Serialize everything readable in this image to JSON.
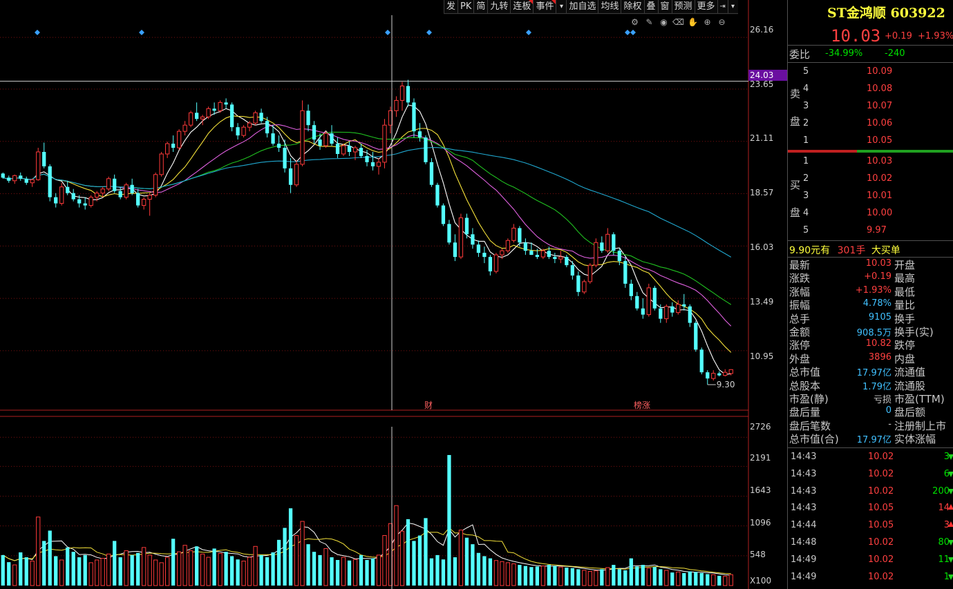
{
  "toolbar": {
    "buttons": [
      "发",
      "PK",
      "简",
      "九转",
      "连板",
      "事件",
      "▾",
      "加自选",
      "均线",
      "除权",
      "叠",
      "窗",
      "预测",
      "更多",
      "⇥",
      "▾"
    ]
  },
  "chart_data": [
    {
      "type": "candlestick",
      "title": "",
      "price_axis_ticks": [
        "26.16",
        "23.65",
        "21.11",
        "18.57",
        "16.03",
        "13.49",
        "10.95"
      ],
      "ylim": [
        9.0,
        26.5
      ],
      "cursor_price": "24.03",
      "low_marker": "9.30",
      "event_markers": [
        "财",
        "榜涨"
      ],
      "moving_average_colors": [
        "#ffffff",
        "#f5e23a",
        "#e060e0",
        "#20c020",
        "#20a8d0"
      ],
      "up_color": "#ff3a3a",
      "down_color": "#54ffff",
      "candles": [
        [
          19.55,
          19.6,
          19.3,
          19.35
        ],
        [
          19.35,
          19.45,
          19.1,
          19.2
        ],
        [
          19.2,
          19.5,
          19.05,
          19.45
        ],
        [
          19.45,
          19.6,
          19.2,
          19.3
        ],
        [
          19.3,
          19.4,
          19.0,
          19.1
        ],
        [
          19.1,
          19.3,
          18.9,
          19.25
        ],
        [
          19.25,
          20.8,
          19.2,
          20.6
        ],
        [
          20.6,
          21.05,
          19.8,
          19.9
        ],
        [
          19.9,
          20.0,
          18.2,
          18.4
        ],
        [
          18.4,
          18.6,
          17.9,
          18.1
        ],
        [
          18.1,
          19.1,
          18.0,
          18.9
        ],
        [
          18.9,
          19.2,
          18.5,
          18.6
        ],
        [
          18.6,
          18.8,
          18.2,
          18.3
        ],
        [
          18.3,
          18.5,
          17.9,
          18.1
        ],
        [
          18.1,
          18.4,
          17.8,
          18.0
        ],
        [
          18.0,
          18.5,
          17.9,
          18.4
        ],
        [
          18.4,
          18.7,
          18.2,
          18.6
        ],
        [
          18.6,
          18.9,
          18.4,
          18.8
        ],
        [
          18.8,
          19.4,
          18.7,
          19.3
        ],
        [
          19.3,
          19.5,
          18.6,
          18.7
        ],
        [
          18.7,
          18.9,
          18.3,
          18.4
        ],
        [
          18.4,
          19.1,
          18.3,
          19.0
        ],
        [
          19.0,
          19.3,
          18.5,
          18.6
        ],
        [
          18.6,
          18.8,
          17.9,
          18.0
        ],
        [
          18.0,
          18.4,
          17.8,
          18.3
        ],
        [
          18.3,
          18.6,
          17.5,
          18.5
        ],
        [
          18.5,
          19.6,
          18.4,
          19.5
        ],
        [
          19.5,
          20.6,
          19.4,
          20.5
        ],
        [
          20.5,
          21.1,
          20.3,
          21.0
        ],
        [
          21.0,
          21.4,
          20.6,
          20.8
        ],
        [
          20.8,
          21.7,
          20.7,
          21.6
        ],
        [
          21.6,
          22.1,
          21.4,
          21.9
        ],
        [
          21.9,
          22.6,
          21.8,
          22.5
        ],
        [
          22.5,
          23.0,
          22.1,
          22.2
        ],
        [
          22.2,
          22.4,
          21.9,
          22.3
        ],
        [
          22.3,
          22.8,
          22.2,
          22.7
        ],
        [
          22.7,
          23.0,
          22.4,
          22.6
        ],
        [
          22.6,
          23.1,
          22.5,
          23.0
        ],
        [
          23.0,
          23.2,
          22.7,
          22.9
        ],
        [
          22.9,
          23.0,
          21.6,
          21.8
        ],
        [
          21.8,
          22.0,
          21.2,
          21.4
        ],
        [
          21.4,
          21.9,
          21.3,
          21.8
        ],
        [
          21.8,
          22.1,
          21.6,
          22.0
        ],
        [
          22.0,
          22.6,
          21.9,
          22.5
        ],
        [
          22.5,
          22.7,
          22.0,
          22.1
        ],
        [
          22.1,
          22.3,
          21.3,
          21.5
        ],
        [
          21.5,
          21.9,
          20.9,
          21.0
        ],
        [
          21.0,
          21.4,
          20.6,
          20.8
        ],
        [
          20.8,
          21.2,
          19.6,
          19.8
        ],
        [
          19.8,
          20.3,
          18.6,
          19.0
        ],
        [
          19.0,
          20.2,
          18.9,
          20.0
        ],
        [
          20.0,
          23.1,
          19.9,
          22.6
        ],
        [
          22.6,
          22.9,
          21.6,
          21.9
        ],
        [
          21.9,
          22.1,
          21.0,
          21.2
        ],
        [
          21.2,
          21.5,
          20.7,
          20.9
        ],
        [
          20.9,
          21.6,
          20.8,
          21.5
        ],
        [
          21.5,
          21.9,
          20.9,
          21.0
        ],
        [
          21.0,
          21.3,
          20.3,
          20.5
        ],
        [
          20.5,
          21.0,
          20.4,
          20.9
        ],
        [
          20.9,
          21.1,
          20.4,
          20.6
        ],
        [
          20.6,
          20.9,
          20.2,
          20.8
        ],
        [
          20.8,
          21.0,
          20.3,
          20.4
        ],
        [
          20.4,
          20.7,
          19.9,
          20.1
        ],
        [
          20.1,
          20.6,
          19.7,
          19.9
        ],
        [
          19.9,
          20.3,
          19.5,
          20.1
        ],
        [
          20.1,
          22.2,
          19.8,
          21.9
        ],
        [
          21.9,
          22.8,
          21.5,
          22.6
        ],
        [
          22.6,
          23.3,
          22.3,
          23.1
        ],
        [
          23.1,
          24.0,
          22.6,
          23.8
        ],
        [
          23.8,
          24.1,
          22.8,
          23.0
        ],
        [
          23.0,
          23.2,
          21.3,
          21.6
        ],
        [
          21.6,
          22.0,
          21.1,
          21.3
        ],
        [
          21.3,
          21.4,
          20.0,
          20.1
        ],
        [
          20.1,
          20.3,
          18.9,
          19.0
        ],
        [
          19.0,
          19.1,
          17.9,
          18.0
        ],
        [
          18.0,
          18.1,
          17.0,
          17.1
        ],
        [
          17.1,
          17.3,
          16.1,
          16.2
        ],
        [
          16.2,
          16.6,
          15.3,
          15.5
        ],
        [
          15.5,
          17.6,
          15.4,
          17.4
        ],
        [
          17.4,
          17.6,
          16.4,
          16.6
        ],
        [
          16.6,
          16.9,
          15.9,
          16.1
        ],
        [
          16.1,
          16.3,
          15.5,
          15.7
        ],
        [
          15.7,
          16.0,
          15.2,
          15.5
        ],
        [
          15.5,
          15.6,
          14.6,
          14.8
        ],
        [
          14.8,
          15.7,
          14.7,
          15.6
        ],
        [
          15.6,
          15.9,
          15.4,
          15.8
        ],
        [
          15.8,
          16.4,
          15.7,
          16.3
        ],
        [
          16.3,
          17.1,
          16.2,
          16.9
        ],
        [
          16.9,
          17.0,
          16.0,
          16.2
        ],
        [
          16.2,
          16.4,
          15.6,
          15.8
        ],
        [
          15.8,
          16.2,
          15.6,
          15.6
        ],
        [
          15.6,
          15.9,
          15.4,
          15.5
        ],
        [
          15.5,
          15.9,
          15.4,
          15.8
        ],
        [
          15.8,
          16.0,
          15.4,
          15.5
        ],
        [
          15.5,
          15.7,
          15.2,
          15.4
        ],
        [
          15.4,
          15.8,
          15.2,
          15.5
        ],
        [
          15.5,
          15.6,
          15.0,
          15.1
        ],
        [
          15.1,
          15.3,
          14.4,
          14.6
        ],
        [
          14.6,
          14.8,
          13.6,
          13.8
        ],
        [
          13.8,
          14.4,
          13.7,
          14.3
        ],
        [
          14.3,
          15.2,
          14.2,
          15.1
        ],
        [
          15.1,
          16.4,
          15.0,
          16.2
        ],
        [
          16.2,
          16.5,
          15.7,
          15.8
        ],
        [
          15.8,
          16.9,
          15.7,
          16.6
        ],
        [
          16.6,
          16.7,
          15.6,
          15.8
        ],
        [
          15.8,
          15.9,
          15.1,
          15.3
        ],
        [
          15.3,
          15.5,
          14.0,
          14.2
        ],
        [
          14.2,
          14.4,
          13.4,
          13.6
        ],
        [
          13.6,
          13.8,
          12.9,
          13.0
        ],
        [
          13.0,
          13.5,
          12.5,
          12.7
        ],
        [
          12.7,
          14.2,
          12.6,
          14.0
        ],
        [
          14.0,
          14.1,
          12.9,
          13.0
        ],
        [
          13.0,
          13.2,
          12.3,
          12.5
        ],
        [
          12.5,
          13.2,
          12.3,
          13.1
        ],
        [
          13.1,
          13.3,
          12.6,
          12.8
        ],
        [
          12.8,
          13.4,
          12.7,
          13.2
        ],
        [
          13.2,
          13.7,
          12.9,
          13.1
        ],
        [
          13.1,
          13.2,
          12.1,
          12.3
        ],
        [
          12.3,
          12.4,
          10.9,
          11.0
        ],
        [
          11.0,
          11.1,
          9.8,
          9.9
        ],
        [
          9.9,
          10.0,
          9.3,
          9.6
        ],
        [
          9.6,
          10.0,
          9.5,
          9.85
        ],
        [
          9.85,
          9.95,
          9.7,
          9.75
        ],
        [
          9.75,
          10.05,
          9.7,
          9.9
        ],
        [
          9.84,
          10.05,
          9.75,
          10.03
        ]
      ]
    },
    {
      "type": "bar",
      "title": "",
      "volume_axis_ticks": [
        "2726",
        "2191",
        "1643",
        "1096",
        "548"
      ],
      "volume_unit": "X100",
      "ylim": [
        0,
        2920
      ],
      "values": [
        560,
        430,
        380,
        610,
        520,
        450,
        1260,
        820,
        1010,
        540,
        470,
        700,
        620,
        520,
        560,
        420,
        470,
        500,
        580,
        820,
        520,
        640,
        560,
        600,
        700,
        560,
        470,
        420,
        520,
        860,
        620,
        740,
        640,
        720,
        580,
        520,
        680,
        590,
        620,
        540,
        480,
        450,
        520,
        720,
        560,
        520,
        610,
        840,
        1060,
        1420,
        920,
        1180,
        760,
        620,
        560,
        680,
        520,
        470,
        520,
        460,
        480,
        560,
        470,
        500,
        560,
        920,
        1140,
        1470,
        1000,
        1220,
        820,
        920,
        1240,
        500,
        560,
        480,
        2400,
        520,
        1020,
        880,
        760,
        600,
        540,
        500,
        460,
        440,
        420,
        400,
        380,
        360,
        340,
        350,
        360,
        380,
        360,
        340,
        330,
        320,
        300,
        280,
        260,
        270,
        300,
        330,
        380,
        300,
        280,
        500,
        350,
        380,
        320,
        340,
        300,
        280,
        240,
        250,
        230,
        260,
        250,
        230,
        210,
        200,
        180,
        170,
        200
      ]
    }
  ],
  "panel": {
    "title": "ST金鸿顺 603922",
    "last_price": "10.03",
    "change": "+0.19",
    "change_pct": "+1.93%",
    "weibi_label": "委比",
    "weibi": "-34.99%",
    "weicha": "-240",
    "sell_label": [
      "卖",
      "盘"
    ],
    "buy_label": [
      "买",
      "盘"
    ],
    "sell": [
      {
        "idx": "5",
        "price": "10.09"
      },
      {
        "idx": "4",
        "price": "10.08"
      },
      {
        "idx": "3",
        "price": "10.07"
      },
      {
        "idx": "2",
        "price": "10.06"
      },
      {
        "idx": "1",
        "price": "10.05"
      }
    ],
    "buy": [
      {
        "idx": "1",
        "price": "10.03"
      },
      {
        "idx": "2",
        "price": "10.02"
      },
      {
        "idx": "3",
        "price": "10.01"
      },
      {
        "idx": "4",
        "price": "10.00"
      },
      {
        "idx": "5",
        "price": "9.97"
      }
    ],
    "big_order": {
      "price": "9.90",
      "text1": "元有",
      "qty": "301手",
      "text2": "大买单"
    },
    "stats": [
      {
        "label": "最新",
        "value": "10.03",
        "right": "开盘",
        "color": "#ff4040"
      },
      {
        "label": "涨跌",
        "value": "+0.19",
        "right": "最高",
        "color": "#ff4040"
      },
      {
        "label": "涨幅",
        "value": "+1.93%",
        "right": "最低",
        "color": "#ff4040"
      },
      {
        "label": "振幅",
        "value": "4.78%",
        "right": "量比",
        "color": "#40c0ff"
      },
      {
        "label": "总手",
        "value": "9105",
        "right": "换手",
        "color": "#40c0ff"
      },
      {
        "label": "金额",
        "value": "908.5万",
        "right": "换手(实)",
        "color": "#40c0ff"
      },
      {
        "label": "涨停",
        "value": "10.82",
        "right": "跌停",
        "color": "#ff4040"
      },
      {
        "label": "外盘",
        "value": "3896",
        "right": "内盘",
        "color": "#ff4040"
      },
      {
        "label": "总市值",
        "value": "17.97亿",
        "right": "流通值",
        "color": "#40c0ff"
      },
      {
        "label": "总股本",
        "value": "1.79亿",
        "right": "流通股",
        "color": "#40c0ff"
      },
      {
        "label": "市盈(静)",
        "value": "亏损",
        "right": "市盈(TTM)",
        "color": "#c8c8c8"
      },
      {
        "label": "盘后量",
        "value": "0",
        "right": "盘后额",
        "color": "#40c0ff"
      },
      {
        "label": "盘后笔数",
        "value": "-",
        "right": "注册制上市",
        "color": "#c8c8c8"
      },
      {
        "label": "总市值(合)",
        "value": "17.97亿",
        "right": "实体涨幅",
        "color": "#40c0ff"
      }
    ],
    "ticks": [
      {
        "time": "14:43",
        "price": "10.02",
        "vol": "3",
        "dir": "down"
      },
      {
        "time": "14:43",
        "price": "10.02",
        "vol": "6",
        "dir": "down"
      },
      {
        "time": "14:43",
        "price": "10.02",
        "vol": "200",
        "dir": "down"
      },
      {
        "time": "14:43",
        "price": "10.05",
        "vol": "14",
        "dir": "up"
      },
      {
        "time": "14:44",
        "price": "10.05",
        "vol": "3",
        "dir": "up"
      },
      {
        "time": "14:48",
        "price": "10.02",
        "vol": "80",
        "dir": "down"
      },
      {
        "time": "14:49",
        "price": "10.02",
        "vol": "11",
        "dir": "down"
      },
      {
        "time": "14:49",
        "price": "10.02",
        "vol": "1",
        "dir": "down"
      }
    ]
  }
}
